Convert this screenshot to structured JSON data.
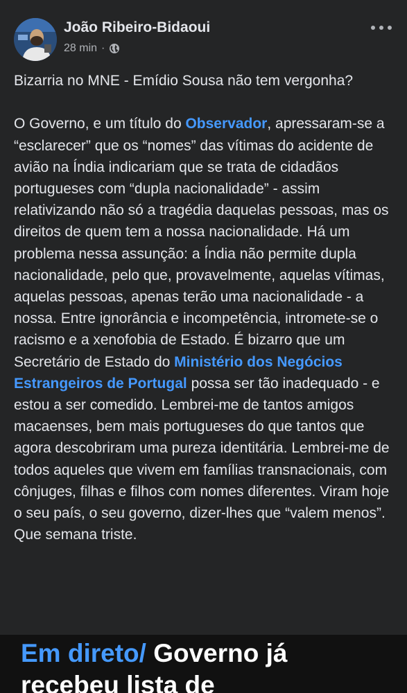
{
  "post": {
    "author": "João Ribeiro-Bidaoui",
    "timestamp": "28 min",
    "separator": "·",
    "privacy_icon": "globe-icon",
    "more_icon": "more-horizontal-icon",
    "title_line": "Bizarria no MNE - Emídio Sousa não tem vergonha?",
    "paragraph": {
      "seg1": "O Governo, e um título do ",
      "link1": "Observador",
      "seg2": ", apressaram-se a “esclarecer” que os “nomes” das vítimas do acidente de avião na Índia indicariam que se trata de cidadãos portugueses com “dupla nacionalidade” - assim relativizando não só a tragédia daquelas pessoas, mas os direitos de quem tem a nossa nacionalidade. Há um problema nessa assunção: a Índia não permite dupla nacionalidade, pelo que, provavelmente, aquelas vítimas, aquelas pessoas, apenas terão uma nacionalidade - a nossa. Entre ignorância e incompetência, intromete-se o racismo e a xenofobia de Estado. É bizarro que um Secretário de Estado do ",
      "link2": "Ministério dos Negócios Estrangeiros de Portugal",
      "seg3": " possa ser tão inadequado - e estou a ser comedido. Lembrei-me de tantos amigos macaenses, bem mais portugueses do que tantos que agora descobriram uma pureza identitária. Lembrei-me de todos aqueles que vivem em famílias transnacionais, com cônjuges, filhas e filhos com nomes diferentes. Viram hoje o seu país, o seu governo, dizer-lhes que “valem menos”. Que semana triste."
    }
  },
  "link_preview": {
    "tag": "Em direto/",
    "headline": " Governo já recebeu lista de"
  },
  "colors": {
    "background": "#242526",
    "text": "#e4e6eb",
    "secondary_text": "#b0b3b8",
    "link": "#4599ff",
    "preview_background": "#111111"
  }
}
